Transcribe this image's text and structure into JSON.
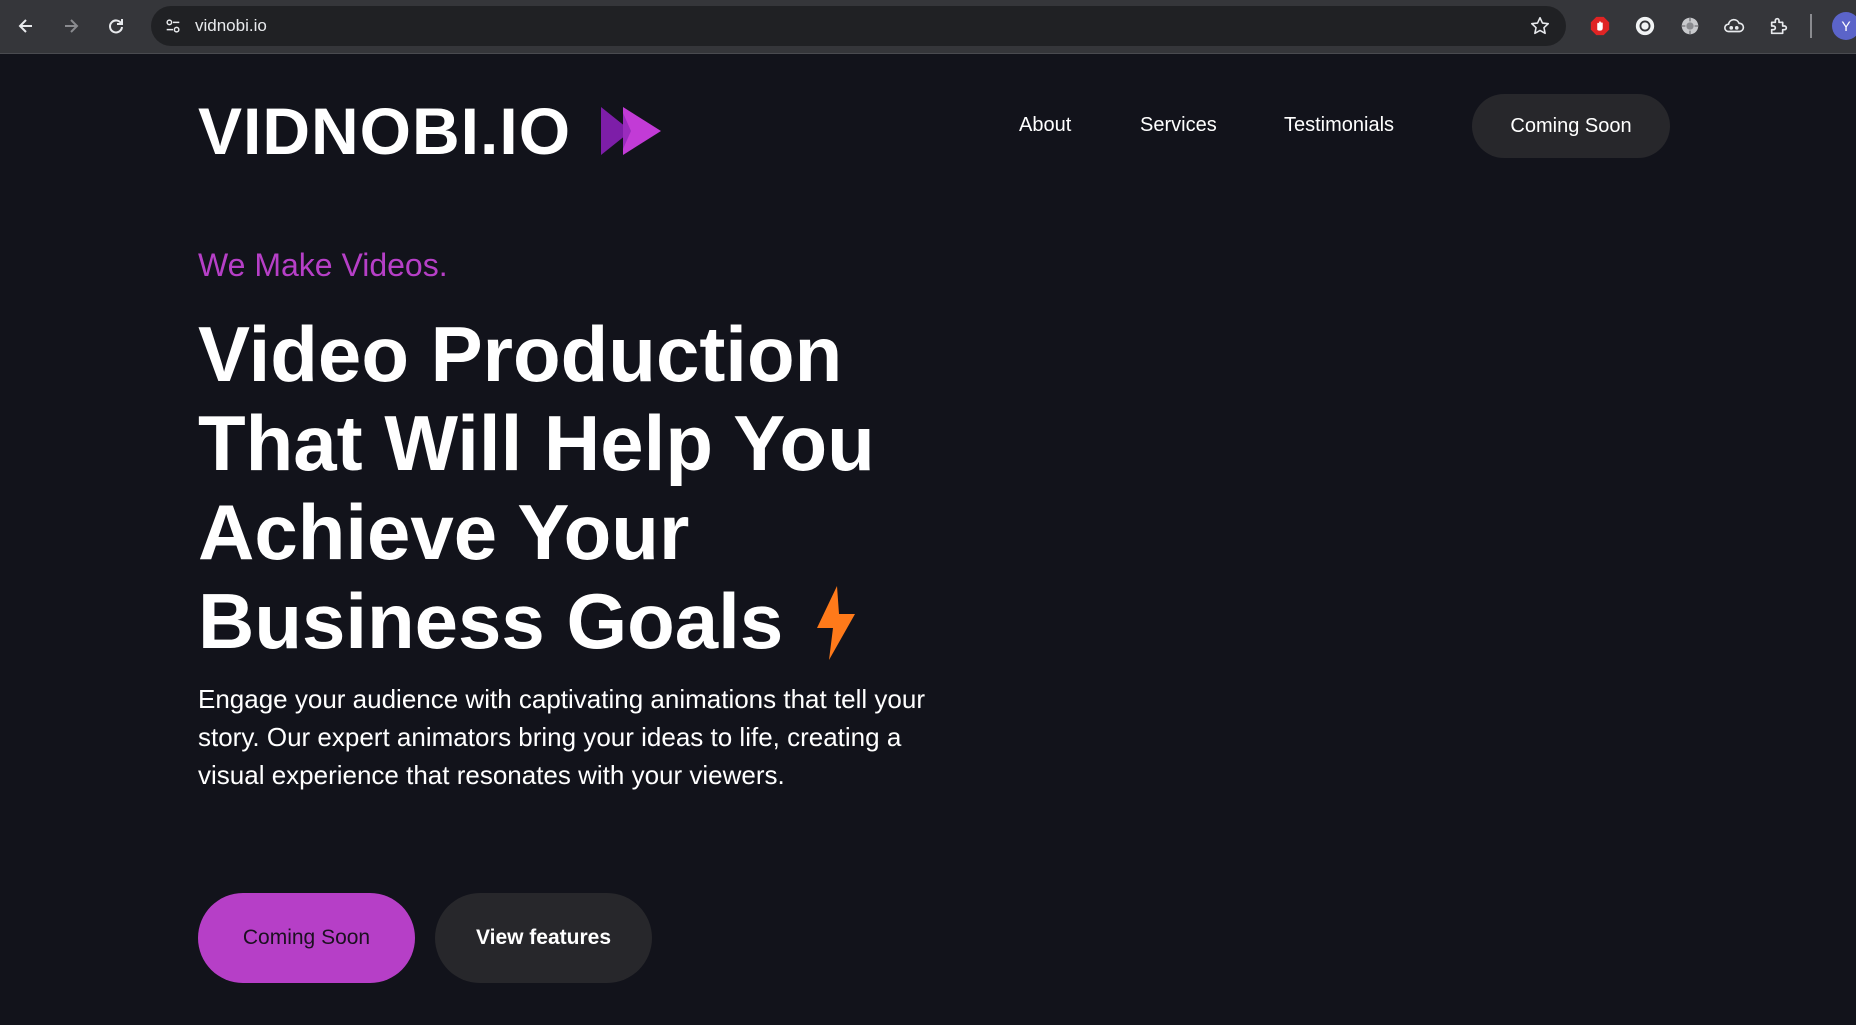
{
  "browser": {
    "url": "vidnobi.io",
    "extensions": [
      "adblock-icon",
      "extension-circle-icon",
      "extension-gear-icon",
      "extension-cloud-icon",
      "extensions-puzzle-icon"
    ],
    "profile_initial": "Y"
  },
  "site": {
    "logo_text": "VIDNOBI.IO",
    "nav": {
      "about": "About",
      "services": "Services",
      "testimonials": "Testimonials",
      "cta": "Coming Soon"
    },
    "hero": {
      "eyebrow": "We Make Videos.",
      "headline_lines": [
        "Video Production",
        "That Will Help You",
        "Achieve Your",
        "Business Goals"
      ],
      "description": "Engage your audience with captivating animations that tell your story. Our expert animators bring your ideas to life, creating a visual experience that resonates with your viewers.",
      "primary_button": "Coming Soon",
      "secondary_button": "View features"
    }
  },
  "colors": {
    "background": "#12131b",
    "accent_purple": "#b63fc7",
    "bolt_orange": "#ff7a1a",
    "button_dark": "#27272b"
  }
}
